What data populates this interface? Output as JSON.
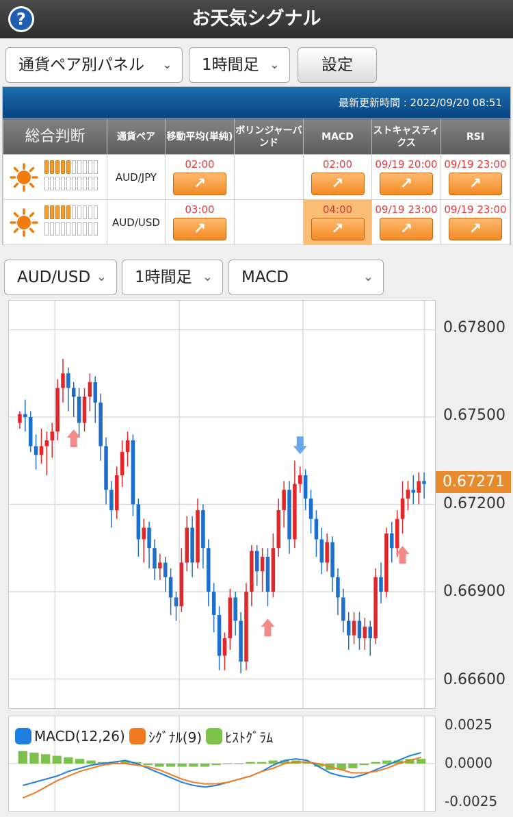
{
  "app": {
    "title": "お天気シグナル"
  },
  "controls": {
    "panel_select": "通貨ペア別パネル",
    "timeframe_select": "1時間足",
    "settings_button": "設定"
  },
  "panel": {
    "update_label": "最新更新時間 : 2022/09/20 08:51",
    "headers": {
      "overall": "総合判断",
      "pair": "通貨ペア",
      "sma": "移動平均(単純)",
      "bollinger": "ボリンジャーバンド",
      "macd": "MACD",
      "stochastics": "ストキャスティクス",
      "rsi": "RSI"
    },
    "rows": [
      {
        "pair": "AUD/JPY",
        "strength": 5,
        "weather": "sunny",
        "sma": "02:00",
        "bollinger": "",
        "macd": "02:00",
        "stochastics": "09/19 20:00",
        "rsi": "09/19 23:00"
      },
      {
        "pair": "AUD/USD",
        "strength": 5,
        "weather": "sunny",
        "sma": "03:00",
        "bollinger": "",
        "macd": "04:00",
        "stochastics": "09/19 23:00",
        "rsi": "09/19 23:00"
      }
    ],
    "arrow_glyph": "↗"
  },
  "chart_controls": {
    "pair_select": "AUD/USD",
    "timeframe_select": "1時間足",
    "indicator_select": "MACD"
  },
  "chart_data": [
    {
      "type": "candlestick",
      "y_ticks": [
        "0.67800",
        "0.67500",
        "0.67200",
        "0.66900",
        "0.66600"
      ],
      "ylim": [
        0.665,
        0.679
      ],
      "current_price": "0.67271",
      "grid": true,
      "candles": [
        [
          0.6748,
          0.6751,
          0.6746,
          0.6752
        ],
        [
          0.6751,
          0.675,
          0.6745,
          0.6756
        ],
        [
          0.675,
          0.674,
          0.6738,
          0.6752
        ],
        [
          0.674,
          0.6737,
          0.6732,
          0.6744
        ],
        [
          0.6737,
          0.674,
          0.6734,
          0.6746
        ],
        [
          0.674,
          0.6742,
          0.673,
          0.6745
        ],
        [
          0.6742,
          0.6745,
          0.6736,
          0.6748
        ],
        [
          0.6745,
          0.676,
          0.6742,
          0.6763
        ],
        [
          0.676,
          0.6765,
          0.6755,
          0.677
        ],
        [
          0.6765,
          0.676,
          0.6752,
          0.6767
        ],
        [
          0.676,
          0.6757,
          0.675,
          0.6762
        ],
        [
          0.6757,
          0.6748,
          0.6743,
          0.676
        ],
        [
          0.6748,
          0.6757,
          0.6745,
          0.676
        ],
        [
          0.6757,
          0.6762,
          0.6752,
          0.6765
        ],
        [
          0.6762,
          0.6755,
          0.6748,
          0.6764
        ],
        [
          0.6755,
          0.674,
          0.6735,
          0.6758
        ],
        [
          0.674,
          0.6725,
          0.672,
          0.6743
        ],
        [
          0.6725,
          0.6718,
          0.6712,
          0.6728
        ],
        [
          0.6718,
          0.673,
          0.6715,
          0.6733
        ],
        [
          0.673,
          0.6738,
          0.6726,
          0.6742
        ],
        [
          0.6738,
          0.6742,
          0.6733,
          0.6745
        ],
        [
          0.6742,
          0.672,
          0.6716,
          0.6744
        ],
        [
          0.672,
          0.6708,
          0.6702,
          0.6722
        ],
        [
          0.6708,
          0.6712,
          0.67,
          0.6715
        ],
        [
          0.6712,
          0.6705,
          0.6698,
          0.6714
        ],
        [
          0.6705,
          0.6698,
          0.6694,
          0.6708
        ],
        [
          0.6698,
          0.67,
          0.6694,
          0.6703
        ],
        [
          0.67,
          0.6695,
          0.669,
          0.6702
        ],
        [
          0.6695,
          0.6688,
          0.6682,
          0.6698
        ],
        [
          0.6688,
          0.6685,
          0.668,
          0.669
        ],
        [
          0.6685,
          0.67,
          0.6683,
          0.6705
        ],
        [
          0.67,
          0.6712,
          0.6697,
          0.6716
        ],
        [
          0.6712,
          0.67,
          0.6695,
          0.6716
        ],
        [
          0.67,
          0.6718,
          0.6698,
          0.6722
        ],
        [
          0.6718,
          0.6705,
          0.6698,
          0.672
        ],
        [
          0.6705,
          0.669,
          0.6685,
          0.6708
        ],
        [
          0.669,
          0.6682,
          0.6676,
          0.6693
        ],
        [
          0.6682,
          0.6668,
          0.6663,
          0.6685
        ],
        [
          0.6668,
          0.6674,
          0.6663,
          0.6676
        ],
        [
          0.6674,
          0.6688,
          0.667,
          0.6691
        ],
        [
          0.6688,
          0.668,
          0.6675,
          0.669
        ],
        [
          0.668,
          0.6666,
          0.6662,
          0.6683
        ],
        [
          0.6666,
          0.669,
          0.6663,
          0.6693
        ],
        [
          0.669,
          0.6704,
          0.6685,
          0.6706
        ],
        [
          0.6704,
          0.6697,
          0.6692,
          0.6706
        ],
        [
          0.6697,
          0.6702,
          0.669,
          0.6705
        ],
        [
          0.6702,
          0.669,
          0.6685,
          0.6705
        ],
        [
          0.669,
          0.6705,
          0.6688,
          0.671
        ],
        [
          0.6705,
          0.6718,
          0.6702,
          0.6722
        ],
        [
          0.6718,
          0.6725,
          0.6712,
          0.6728
        ],
        [
          0.6725,
          0.6708,
          0.6703,
          0.6728
        ],
        [
          0.6708,
          0.6727,
          0.6705,
          0.6735
        ],
        [
          0.6727,
          0.673,
          0.6724,
          0.6733
        ],
        [
          0.673,
          0.6722,
          0.6718,
          0.6732
        ],
        [
          0.6722,
          0.6715,
          0.671,
          0.6725
        ],
        [
          0.6715,
          0.6708,
          0.6702,
          0.6718
        ],
        [
          0.6708,
          0.67,
          0.6696,
          0.6712
        ],
        [
          0.67,
          0.6707,
          0.6697,
          0.671
        ],
        [
          0.6707,
          0.6695,
          0.669,
          0.6709
        ],
        [
          0.6695,
          0.6688,
          0.6682,
          0.6698
        ],
        [
          0.6688,
          0.668,
          0.6676,
          0.6691
        ],
        [
          0.668,
          0.6675,
          0.667,
          0.6683
        ],
        [
          0.6675,
          0.668,
          0.6672,
          0.6683
        ],
        [
          0.668,
          0.6674,
          0.667,
          0.6683
        ],
        [
          0.6674,
          0.6678,
          0.667,
          0.6681
        ],
        [
          0.6678,
          0.6674,
          0.6668,
          0.668
        ],
        [
          0.6674,
          0.6695,
          0.6672,
          0.6698
        ],
        [
          0.6695,
          0.669,
          0.6686,
          0.67
        ],
        [
          0.669,
          0.671,
          0.6688,
          0.6712
        ],
        [
          0.671,
          0.6705,
          0.67,
          0.6714
        ],
        [
          0.6705,
          0.6715,
          0.6702,
          0.6718
        ],
        [
          0.6715,
          0.6722,
          0.671,
          0.6728
        ],
        [
          0.6722,
          0.6725,
          0.6718,
          0.6728
        ],
        [
          0.6725,
          0.6724,
          0.672,
          0.673
        ],
        [
          0.6724,
          0.6728,
          0.672,
          0.6731
        ],
        [
          0.6728,
          0.6727,
          0.6722,
          0.6731
        ]
      ],
      "signals": [
        {
          "index": 10,
          "direction": "up",
          "color": "#f48a8a"
        },
        {
          "index": 46,
          "direction": "up",
          "color": "#f48a8a"
        },
        {
          "index": 52,
          "direction": "down",
          "color": "#6aa6ea"
        },
        {
          "index": 71,
          "direction": "up",
          "color": "#f48a8a"
        }
      ],
      "colors": {
        "up": "#e3262a",
        "down": "#1e6ecb"
      }
    },
    {
      "type": "line",
      "y_ticks": [
        "0.0025",
        "0.0000",
        "-0.0025"
      ],
      "ylim": [
        -0.0025,
        0.0025
      ],
      "legend": [
        "MACD(12,26)",
        "ｼｸﾞﾅﾙ(9)",
        "ﾋｽﾄｸﾞﾗﾑ"
      ],
      "series": [
        {
          "name": "MACD(12,26)",
          "color": "#1e7ee0",
          "values": [
            -0.0014,
            -0.0012,
            -0.001,
            -0.0008,
            -0.0005,
            -0.0003,
            -0.0001,
            0.0,
            0.0001,
            0.0002,
            0.0,
            -0.0003,
            -0.0006,
            -0.0009,
            -0.0012,
            -0.0014,
            -0.0015,
            -0.0014,
            -0.0012,
            -0.001,
            -0.0008,
            -0.0005,
            -0.0001,
            0.0002,
            0.0003,
            0.0002,
            -0.0002,
            -0.0006,
            -0.0008,
            -0.0009,
            -0.0007,
            -0.0004,
            -0.0001,
            0.0002,
            0.0005,
            0.0007
          ]
        },
        {
          "name": "ｼｸﾞﾅﾙ(9)",
          "color": "#f07a22",
          "values": [
            -0.0022,
            -0.0019,
            -0.0015,
            -0.0011,
            -0.0008,
            -0.0005,
            -0.0003,
            -0.0001,
            0.0,
            0.0,
            -0.0001,
            -0.0002,
            -0.0004,
            -0.0007,
            -0.001,
            -0.0012,
            -0.0013,
            -0.0013,
            -0.0012,
            -0.001,
            -0.0008,
            -0.0005,
            -0.0003,
            0.0,
            0.0001,
            0.0001,
            0.0,
            -0.0002,
            -0.0004,
            -0.0006,
            -0.0006,
            -0.0005,
            -0.0003,
            0.0,
            0.0002,
            0.0004
          ]
        },
        {
          "name": "ﾋｽﾄｸﾞﾗﾑ",
          "color": "#7cc24a",
          "type": "bar",
          "values": [
            0.0008,
            0.0007,
            0.0006,
            0.0005,
            0.0004,
            0.0003,
            0.0002,
            0.0001,
            0.0001,
            0.0002,
            0.0001,
            -0.0001,
            -0.0002,
            -0.0002,
            -0.0002,
            -0.0002,
            -0.0002,
            -0.0001,
            0.0,
            0.0,
            0.0001,
            0.0001,
            0.0002,
            0.0002,
            0.0002,
            0.0001,
            -0.0002,
            -0.0004,
            -0.0004,
            -0.0003,
            -0.0001,
            0.0001,
            0.0002,
            0.0002,
            0.0003,
            0.0003
          ]
        }
      ]
    }
  ]
}
